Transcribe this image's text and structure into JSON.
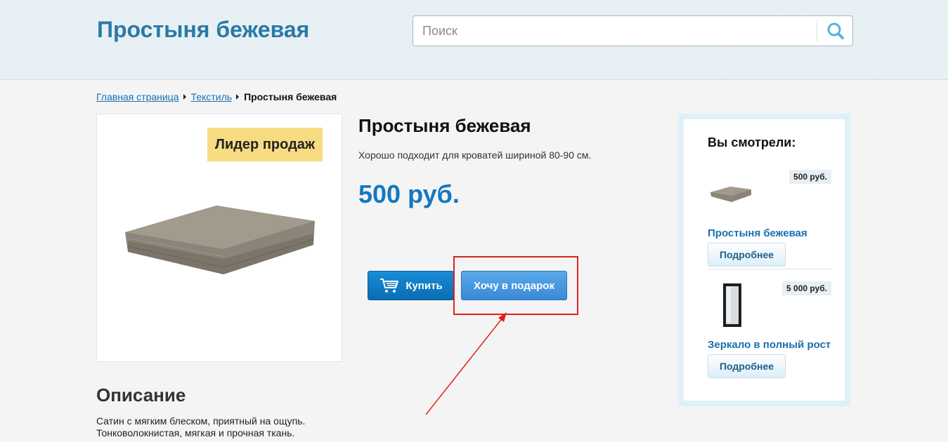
{
  "header": {
    "site_title": "Простыня бежевая",
    "search_placeholder": "Поиск",
    "search_icon": "search-icon"
  },
  "breadcrumb": {
    "items": [
      "Главная страница",
      "Текстиль"
    ],
    "current": "Простыня бежевая"
  },
  "product": {
    "badge": "Лидер продаж",
    "title": "Простыня бежевая",
    "description": "Хорошо подходит для кроватей шириной 80-90 см.",
    "price": "500 руб.",
    "buy_label": "Купить",
    "buy_icon": "cart-icon",
    "gift_label": "Хочу в подарок"
  },
  "description": {
    "heading": "Описание",
    "lines": [
      "Сатин с мягким блеском, приятный на ощупь.",
      "Тонковолокнистая, мягкая и прочная ткань."
    ]
  },
  "sidebar": {
    "title": "Вы смотрели:",
    "items": [
      {
        "name": "Простыня бежевая",
        "price": "500 руб.",
        "more_label": "Подробнее"
      },
      {
        "name": "Зеркало в полный рост",
        "price": "5 000 руб.",
        "more_label": "Подробнее"
      }
    ]
  },
  "colors": {
    "accent": "#1478c2",
    "link": "#1a6fae",
    "badge": "#f8dc81",
    "highlight": "#e02020"
  }
}
